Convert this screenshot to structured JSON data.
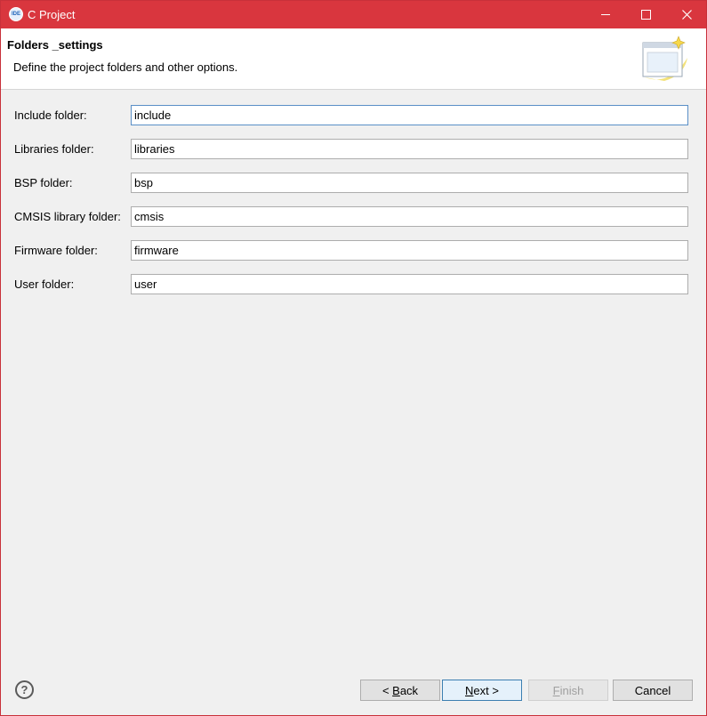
{
  "window": {
    "title": "C Project",
    "app_icon": "IDE"
  },
  "banner": {
    "title": "Folders _settings",
    "description": "Define the project folders and other options."
  },
  "form": {
    "include": {
      "label": "Include folder:",
      "value": "include"
    },
    "libraries": {
      "label": "Libraries folder:",
      "value": "libraries"
    },
    "bsp": {
      "label": "BSP folder:",
      "value": "bsp"
    },
    "cmsis": {
      "label": "CMSIS library folder:",
      "value": "cmsis"
    },
    "firmware": {
      "label": "Firmware folder:",
      "value": "firmware"
    },
    "user": {
      "label": "User folder:",
      "value": "user"
    }
  },
  "buttons": {
    "back": {
      "prefix": "< ",
      "mnemonic": "B",
      "rest": "ack"
    },
    "next": {
      "mnemonic": "N",
      "rest": "ext",
      "suffix": " >"
    },
    "finish": {
      "mnemonic": "F",
      "rest": "inish"
    },
    "cancel": {
      "label": "Cancel"
    }
  },
  "colors": {
    "titlebar": "#d9363e",
    "window_bg": "#f0f0f0",
    "focus_border": "#5a8fc7"
  },
  "icons": [
    "app-icon",
    "minimize-icon",
    "maximize-icon",
    "close-icon",
    "wizard-banner-icon",
    "help-icon"
  ]
}
